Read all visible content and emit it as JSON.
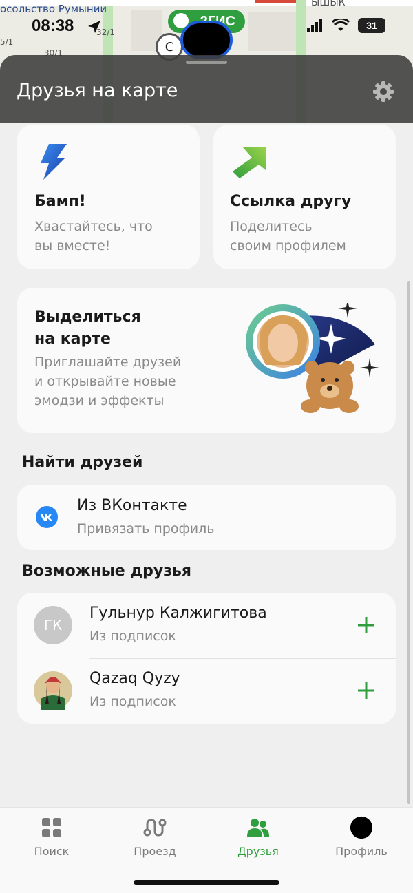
{
  "status": {
    "time": "08:38",
    "brand": "2ГИС",
    "battery": "31"
  },
  "map": {
    "label_top": "осольство Румынии",
    "label_street": "ЫШЫК",
    "building_numbers": [
      "32/1",
      "30/1",
      "5/1"
    ],
    "marker_letter": "С"
  },
  "header": {
    "title": "Друзья на карте"
  },
  "cards": {
    "bump": {
      "title": "Бамп!",
      "subtitle": "Хвастайтесь, что\nвы вместе!"
    },
    "link": {
      "title": "Ссылка другу",
      "subtitle": "Поделитесь\nсвоим профилем"
    },
    "highlight": {
      "title": "Выделиться\nна карте",
      "subtitle": "Приглашайте друзей\nи открывайте новые\nэмодзи и эффекты"
    }
  },
  "find_friends": {
    "section_title": "Найти друзей",
    "vk": {
      "title": "Из ВКонтакте",
      "subtitle": "Привязать профиль"
    }
  },
  "possible_friends": {
    "section_title": "Возможные друзья",
    "items": [
      {
        "name": "Гульнур Калжигитова",
        "source": "Из подписок",
        "initials": "ГК"
      },
      {
        "name": "Qazaq Qyzy",
        "source": "Из подписок",
        "initials": ""
      }
    ]
  },
  "tabs": [
    {
      "label": "Поиск",
      "icon": "grid-icon",
      "active": false
    },
    {
      "label": "Проезд",
      "icon": "route-icon",
      "active": false
    },
    {
      "label": "Друзья",
      "icon": "friends-icon",
      "active": true
    },
    {
      "label": "Профиль",
      "icon": "avatar-icon",
      "active": false
    }
  ],
  "colors": {
    "accent": "#2f9e3e",
    "vk": "#2787f5",
    "header_bg": "#3c3c3c"
  }
}
